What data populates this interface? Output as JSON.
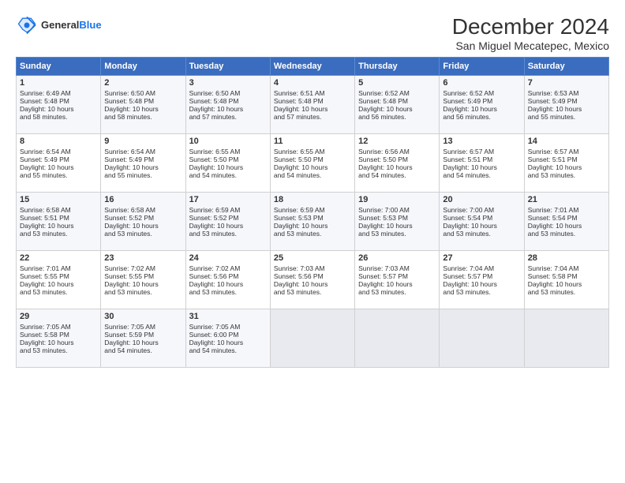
{
  "header": {
    "logo_line1": "General",
    "logo_line2": "Blue",
    "title": "December 2024",
    "subtitle": "San Miguel Mecatepec, Mexico"
  },
  "columns": [
    "Sunday",
    "Monday",
    "Tuesday",
    "Wednesday",
    "Thursday",
    "Friday",
    "Saturday"
  ],
  "rows": [
    [
      {
        "day": "1",
        "lines": [
          "Sunrise: 6:49 AM",
          "Sunset: 5:48 PM",
          "Daylight: 10 hours",
          "and 58 minutes."
        ]
      },
      {
        "day": "2",
        "lines": [
          "Sunrise: 6:50 AM",
          "Sunset: 5:48 PM",
          "Daylight: 10 hours",
          "and 58 minutes."
        ]
      },
      {
        "day": "3",
        "lines": [
          "Sunrise: 6:50 AM",
          "Sunset: 5:48 PM",
          "Daylight: 10 hours",
          "and 57 minutes."
        ]
      },
      {
        "day": "4",
        "lines": [
          "Sunrise: 6:51 AM",
          "Sunset: 5:48 PM",
          "Daylight: 10 hours",
          "and 57 minutes."
        ]
      },
      {
        "day": "5",
        "lines": [
          "Sunrise: 6:52 AM",
          "Sunset: 5:48 PM",
          "Daylight: 10 hours",
          "and 56 minutes."
        ]
      },
      {
        "day": "6",
        "lines": [
          "Sunrise: 6:52 AM",
          "Sunset: 5:49 PM",
          "Daylight: 10 hours",
          "and 56 minutes."
        ]
      },
      {
        "day": "7",
        "lines": [
          "Sunrise: 6:53 AM",
          "Sunset: 5:49 PM",
          "Daylight: 10 hours",
          "and 55 minutes."
        ]
      }
    ],
    [
      {
        "day": "8",
        "lines": [
          "Sunrise: 6:54 AM",
          "Sunset: 5:49 PM",
          "Daylight: 10 hours",
          "and 55 minutes."
        ]
      },
      {
        "day": "9",
        "lines": [
          "Sunrise: 6:54 AM",
          "Sunset: 5:49 PM",
          "Daylight: 10 hours",
          "and 55 minutes."
        ]
      },
      {
        "day": "10",
        "lines": [
          "Sunrise: 6:55 AM",
          "Sunset: 5:50 PM",
          "Daylight: 10 hours",
          "and 54 minutes."
        ]
      },
      {
        "day": "11",
        "lines": [
          "Sunrise: 6:55 AM",
          "Sunset: 5:50 PM",
          "Daylight: 10 hours",
          "and 54 minutes."
        ]
      },
      {
        "day": "12",
        "lines": [
          "Sunrise: 6:56 AM",
          "Sunset: 5:50 PM",
          "Daylight: 10 hours",
          "and 54 minutes."
        ]
      },
      {
        "day": "13",
        "lines": [
          "Sunrise: 6:57 AM",
          "Sunset: 5:51 PM",
          "Daylight: 10 hours",
          "and 54 minutes."
        ]
      },
      {
        "day": "14",
        "lines": [
          "Sunrise: 6:57 AM",
          "Sunset: 5:51 PM",
          "Daylight: 10 hours",
          "and 53 minutes."
        ]
      }
    ],
    [
      {
        "day": "15",
        "lines": [
          "Sunrise: 6:58 AM",
          "Sunset: 5:51 PM",
          "Daylight: 10 hours",
          "and 53 minutes."
        ]
      },
      {
        "day": "16",
        "lines": [
          "Sunrise: 6:58 AM",
          "Sunset: 5:52 PM",
          "Daylight: 10 hours",
          "and 53 minutes."
        ]
      },
      {
        "day": "17",
        "lines": [
          "Sunrise: 6:59 AM",
          "Sunset: 5:52 PM",
          "Daylight: 10 hours",
          "and 53 minutes."
        ]
      },
      {
        "day": "18",
        "lines": [
          "Sunrise: 6:59 AM",
          "Sunset: 5:53 PM",
          "Daylight: 10 hours",
          "and 53 minutes."
        ]
      },
      {
        "day": "19",
        "lines": [
          "Sunrise: 7:00 AM",
          "Sunset: 5:53 PM",
          "Daylight: 10 hours",
          "and 53 minutes."
        ]
      },
      {
        "day": "20",
        "lines": [
          "Sunrise: 7:00 AM",
          "Sunset: 5:54 PM",
          "Daylight: 10 hours",
          "and 53 minutes."
        ]
      },
      {
        "day": "21",
        "lines": [
          "Sunrise: 7:01 AM",
          "Sunset: 5:54 PM",
          "Daylight: 10 hours",
          "and 53 minutes."
        ]
      }
    ],
    [
      {
        "day": "22",
        "lines": [
          "Sunrise: 7:01 AM",
          "Sunset: 5:55 PM",
          "Daylight: 10 hours",
          "and 53 minutes."
        ]
      },
      {
        "day": "23",
        "lines": [
          "Sunrise: 7:02 AM",
          "Sunset: 5:55 PM",
          "Daylight: 10 hours",
          "and 53 minutes."
        ]
      },
      {
        "day": "24",
        "lines": [
          "Sunrise: 7:02 AM",
          "Sunset: 5:56 PM",
          "Daylight: 10 hours",
          "and 53 minutes."
        ]
      },
      {
        "day": "25",
        "lines": [
          "Sunrise: 7:03 AM",
          "Sunset: 5:56 PM",
          "Daylight: 10 hours",
          "and 53 minutes."
        ]
      },
      {
        "day": "26",
        "lines": [
          "Sunrise: 7:03 AM",
          "Sunset: 5:57 PM",
          "Daylight: 10 hours",
          "and 53 minutes."
        ]
      },
      {
        "day": "27",
        "lines": [
          "Sunrise: 7:04 AM",
          "Sunset: 5:57 PM",
          "Daylight: 10 hours",
          "and 53 minutes."
        ]
      },
      {
        "day": "28",
        "lines": [
          "Sunrise: 7:04 AM",
          "Sunset: 5:58 PM",
          "Daylight: 10 hours",
          "and 53 minutes."
        ]
      }
    ],
    [
      {
        "day": "29",
        "lines": [
          "Sunrise: 7:05 AM",
          "Sunset: 5:58 PM",
          "Daylight: 10 hours",
          "and 53 minutes."
        ]
      },
      {
        "day": "30",
        "lines": [
          "Sunrise: 7:05 AM",
          "Sunset: 5:59 PM",
          "Daylight: 10 hours",
          "and 54 minutes."
        ]
      },
      {
        "day": "31",
        "lines": [
          "Sunrise: 7:05 AM",
          "Sunset: 6:00 PM",
          "Daylight: 10 hours",
          "and 54 minutes."
        ]
      },
      {
        "day": "",
        "lines": []
      },
      {
        "day": "",
        "lines": []
      },
      {
        "day": "",
        "lines": []
      },
      {
        "day": "",
        "lines": []
      }
    ]
  ]
}
